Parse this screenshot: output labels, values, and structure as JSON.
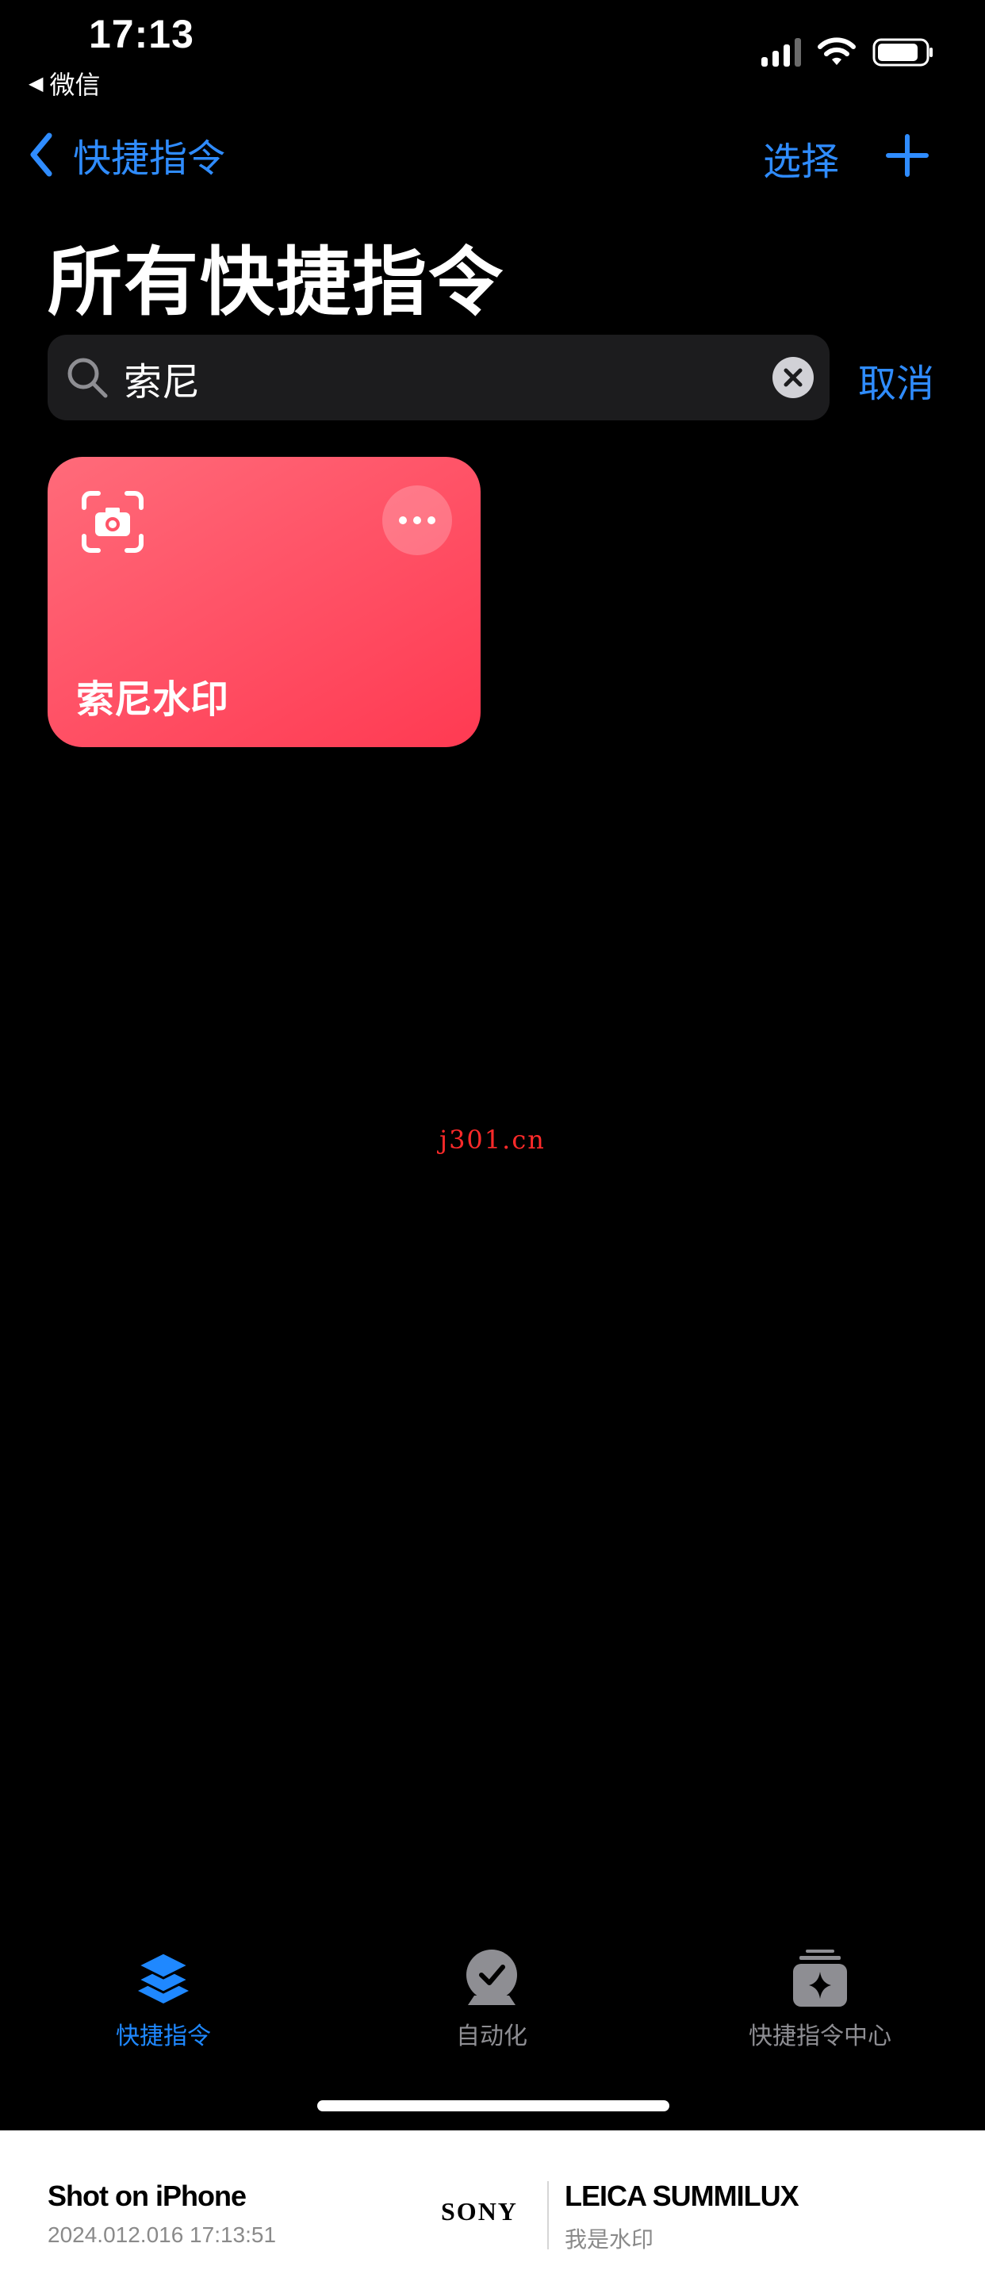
{
  "status_bar": {
    "time": "17:13",
    "back_app": "微信",
    "back_arrow": "◀"
  },
  "nav": {
    "back_label": "快捷指令",
    "select_label": "选择"
  },
  "page_title": "所有快捷指令",
  "search": {
    "value": "索尼",
    "cancel_label": "取消"
  },
  "shortcut_card": {
    "label": "索尼水印",
    "icon": "camera-viewfinder-icon",
    "color": "#ff4a5f"
  },
  "watermark": "j301.cn",
  "tabs": [
    {
      "label": "快捷指令",
      "icon": "stack-icon",
      "active": true
    },
    {
      "label": "自动化",
      "icon": "clock-check-icon",
      "active": false
    },
    {
      "label": "快捷指令中心",
      "icon": "gallery-sparkle-icon",
      "active": false
    }
  ],
  "footer": {
    "left_title": "Shot on iPhone",
    "left_sub": "2024.012.016 17:13:51",
    "brand": "SONY",
    "right_title": "LEICA SUMMILUX",
    "right_sub": "我是水印"
  },
  "colors": {
    "accent": "#2f8cff",
    "background": "#000000",
    "search_bg": "#1c1c1e"
  }
}
